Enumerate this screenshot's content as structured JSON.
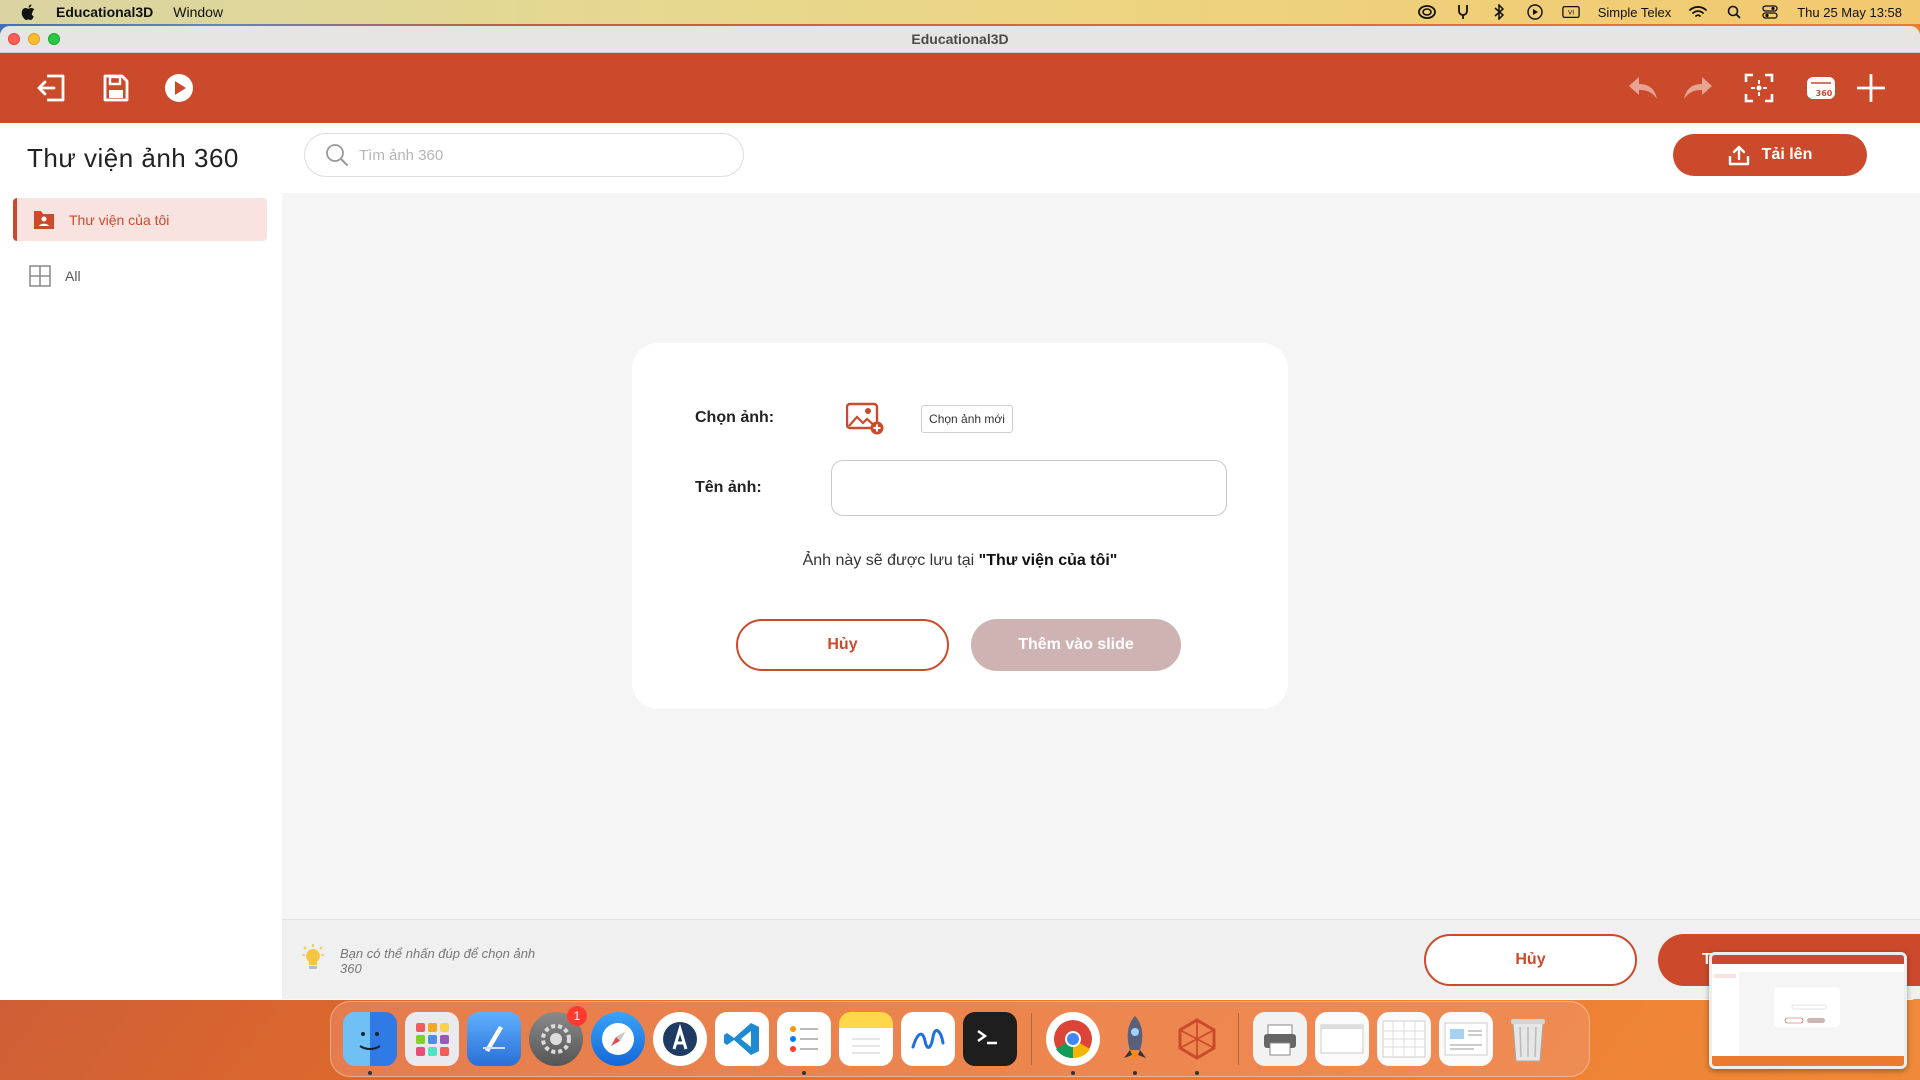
{
  "menubar": {
    "app_name": "Educational3D",
    "menu_window": "Window",
    "input_method": "Simple Telex",
    "datetime": "Thu 25 May  13:58"
  },
  "window": {
    "title": "Educational3D"
  },
  "toolbar": {
    "icons": [
      "exit-icon",
      "save-icon",
      "play-icon",
      "undo-icon",
      "redo-icon",
      "focus-icon",
      "360-view-icon",
      "add-icon"
    ],
    "accent": "#cc4a2c"
  },
  "header": {
    "title": "Thư viện ảnh 360",
    "search_placeholder": "Tìm ảnh 360",
    "upload_label": "Tải lên"
  },
  "sidebar": {
    "items": [
      {
        "label": "Thư viện của tôi",
        "active": true
      },
      {
        "label": "All",
        "active": false
      }
    ]
  },
  "dialog": {
    "choose_label": "Chọn ảnh:",
    "choose_button": "Chọn ảnh mới",
    "name_label": "Tên ảnh:",
    "name_value": "",
    "note_prefix": "Ảnh này sẽ được lưu tại ",
    "note_location": "\"Thư viện của tôi\"",
    "cancel_label": "Hủy",
    "add_label": "Thêm vào slide"
  },
  "footer": {
    "tip": "Bạn có thể nhấn đúp để chọn ảnh 360",
    "cancel_label": "Hủy",
    "add_label": "T"
  },
  "dock": {
    "apps": [
      "finder",
      "launchpad",
      "xcode",
      "system-settings",
      "safari",
      "instruments",
      "vscode",
      "reminders",
      "notes",
      "freeform",
      "terminal",
      "chrome",
      "rocket",
      "educational3d",
      "preview",
      "window-1",
      "window-2",
      "window-3",
      "trash"
    ],
    "settings_badge": "1"
  },
  "colors": {
    "primary": "#cc4a2c",
    "disabled": "#cfb3b3",
    "active_bg": "#f9e3e0"
  }
}
